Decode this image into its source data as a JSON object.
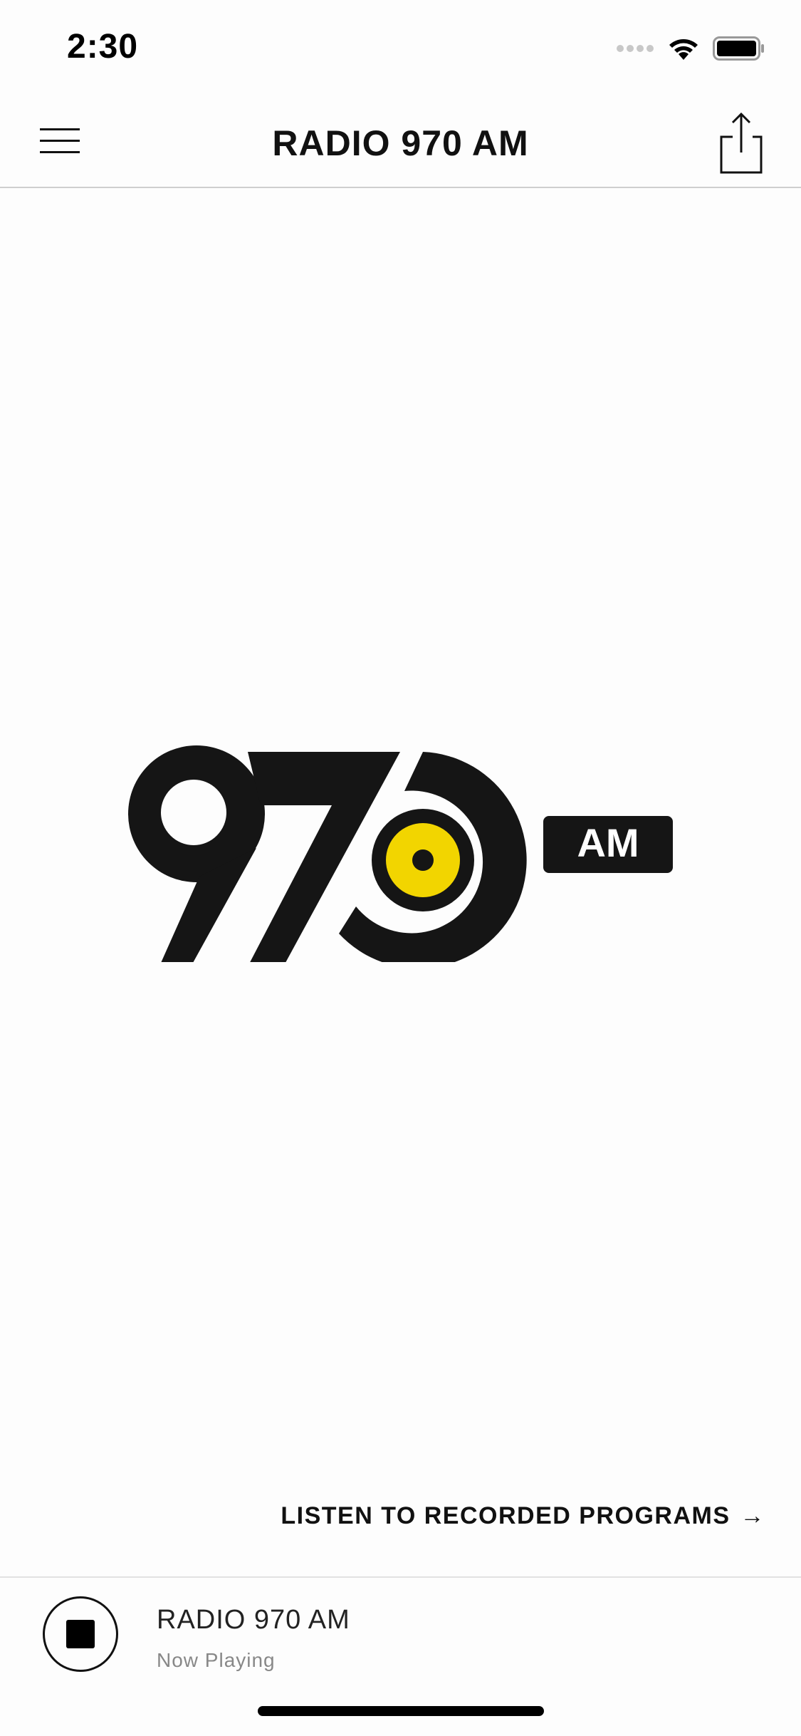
{
  "status_bar": {
    "time": "2:30",
    "icons": [
      "signal-dots-icon",
      "wifi-icon",
      "battery-icon"
    ]
  },
  "nav": {
    "title": "RADIO 970 AM",
    "menu_icon": "hamburger-menu-icon",
    "share_icon": "share-icon"
  },
  "logo": {
    "number": "970",
    "badge": "AM",
    "accent_color": "#f2d500",
    "primary_color": "#151515"
  },
  "recorded": {
    "label": "LISTEN TO RECORDED PROGRAMS",
    "arrow": "→"
  },
  "player": {
    "title": "RADIO 970 AM",
    "subtitle": "Now Playing",
    "control_icon": "stop-icon"
  }
}
